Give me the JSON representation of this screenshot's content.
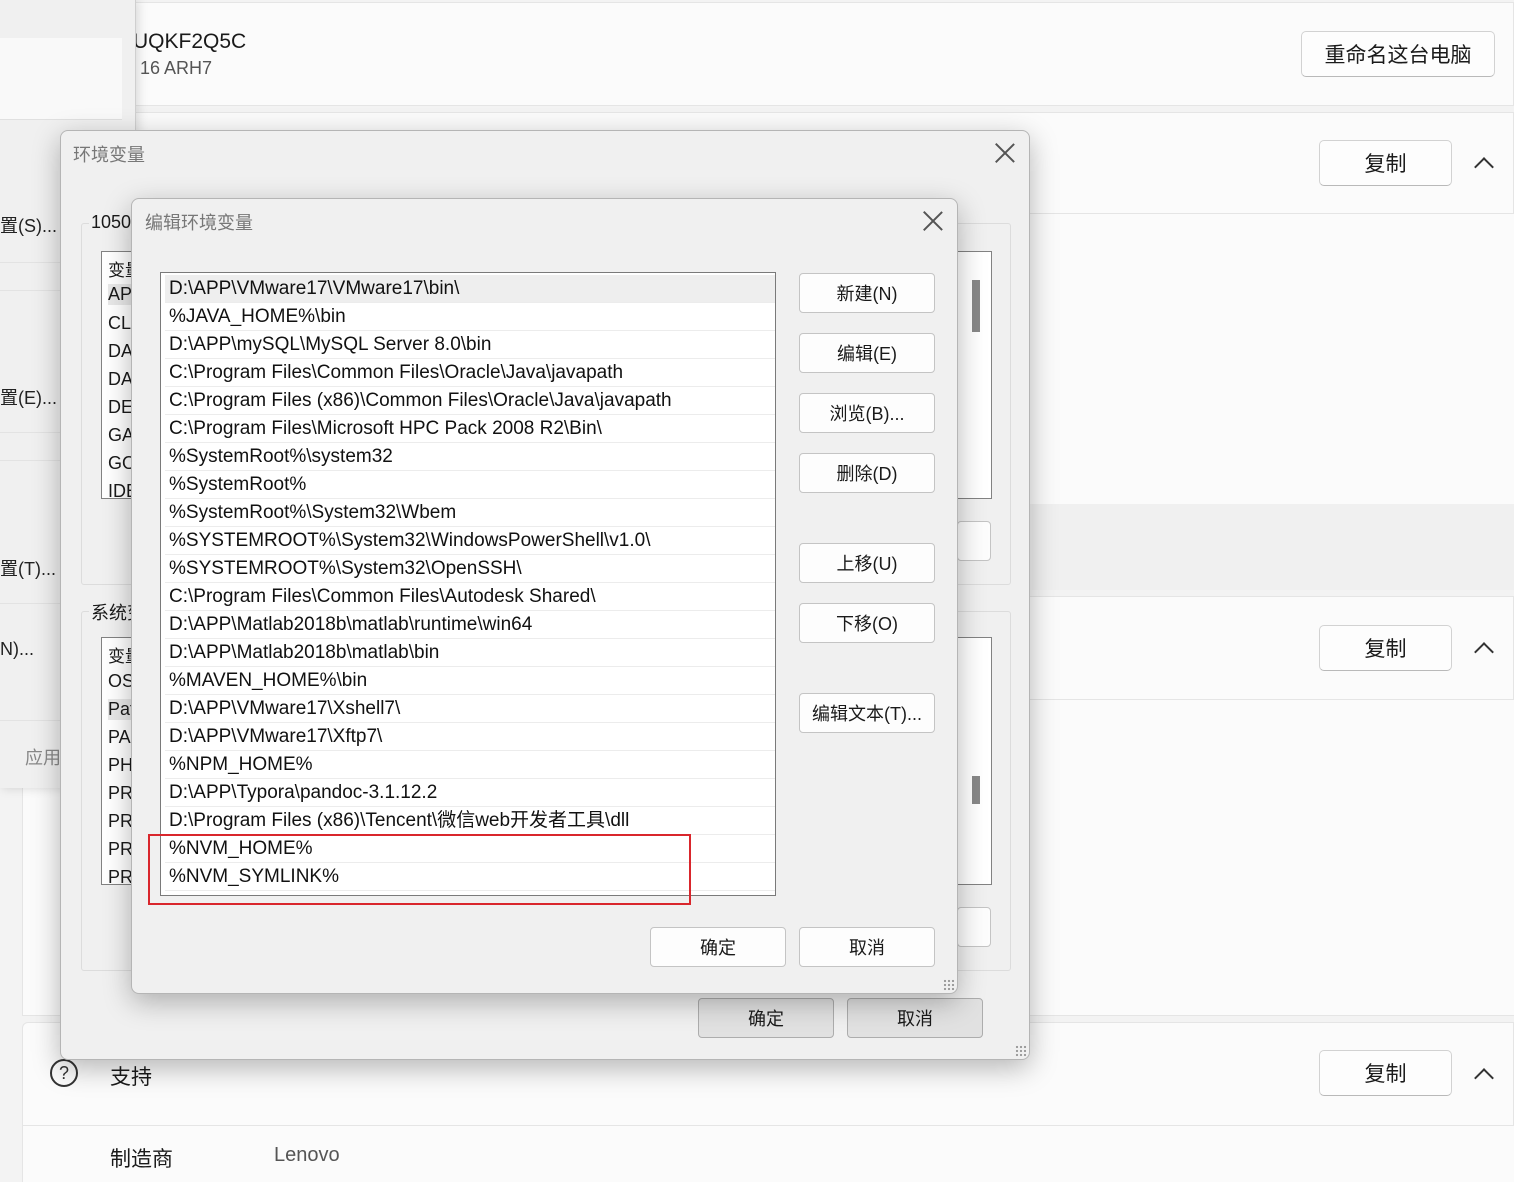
{
  "settings": {
    "device_name_partial": "UQKF2Q5C",
    "device_model_partial": "16 ARH7",
    "rename_button": "重命名这台电脑",
    "copy_button_1": "复制",
    "copy_button_2": "复制",
    "copy_button_3": "复制",
    "support_label": "支持",
    "manufacturer_label": "制造商",
    "manufacturer_value": "Lenovo"
  },
  "sysprops": {
    "items": [
      "置(S)...",
      "置(E)...",
      "置(T)...",
      "N)..."
    ],
    "apply_partial": "应用"
  },
  "envvars_dialog": {
    "title": "环境变量",
    "user_group_partial": "1050",
    "system_group_partial": "系统变",
    "user_list": [
      "变量",
      "AP",
      "CLI",
      "DA",
      "DA",
      "DE",
      "GA",
      "GO",
      "IDE"
    ],
    "system_list": [
      "变量",
      "OS",
      "Pat",
      "PA",
      "PH",
      "PR",
      "PR",
      "PR",
      "PR"
    ],
    "ok": "确定",
    "cancel": "取消"
  },
  "edit_dialog": {
    "title": "编辑环境变量",
    "paths": [
      "D:\\APP\\VMware17\\VMware17\\bin\\",
      "%JAVA_HOME%\\bin",
      "D:\\APP\\mySQL\\MySQL Server 8.0\\bin",
      "C:\\Program Files\\Common Files\\Oracle\\Java\\javapath",
      "C:\\Program Files (x86)\\Common Files\\Oracle\\Java\\javapath",
      "C:\\Program Files\\Microsoft HPC Pack 2008 R2\\Bin\\",
      "%SystemRoot%\\system32",
      "%SystemRoot%",
      "%SystemRoot%\\System32\\Wbem",
      "%SYSTEMROOT%\\System32\\WindowsPowerShell\\v1.0\\",
      "%SYSTEMROOT%\\System32\\OpenSSH\\",
      "C:\\Program Files\\Common Files\\Autodesk Shared\\",
      "D:\\APP\\Matlab2018b\\matlab\\runtime\\win64",
      "D:\\APP\\Matlab2018b\\matlab\\bin",
      "%MAVEN_HOME%\\bin",
      "D:\\APP\\VMware17\\Xshell7\\",
      "D:\\APP\\VMware17\\Xftp7\\",
      "%NPM_HOME%",
      "D:\\APP\\Typora\\pandoc-3.1.12.2",
      "D:\\Program Files (x86)\\Tencent\\微信web开发者工具\\dll",
      "%NVM_HOME%",
      "%NVM_SYMLINK%"
    ],
    "buttons": {
      "new": "新建(N)",
      "edit": "编辑(E)",
      "browse": "浏览(B)...",
      "delete": "删除(D)",
      "move_up": "上移(U)",
      "move_down": "下移(O)",
      "edit_text": "编辑文本(T)..."
    },
    "ok": "确定",
    "cancel": "取消",
    "highlight_color": "#d9262c"
  }
}
